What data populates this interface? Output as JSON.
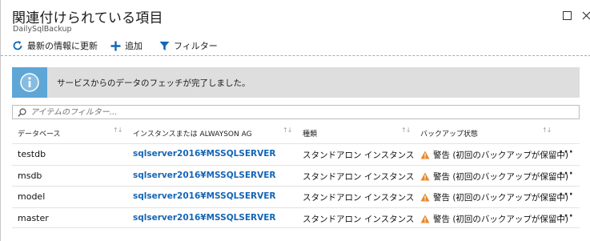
{
  "header": {
    "title": "関連付けられている項目",
    "subtitle": "DailySqlBackup"
  },
  "toolbar": {
    "refresh_label": "最新の情報に更新",
    "add_label": "追加",
    "filter_label": "フィルター"
  },
  "banner": {
    "message": "サービスからのデータのフェッチが完了しました。"
  },
  "filter": {
    "placeholder": "アイテムのフィルター..."
  },
  "grid": {
    "columns": [
      {
        "label": "データベース"
      },
      {
        "label": "インスタンスまたは ALWAYSON AG"
      },
      {
        "label": "種類"
      },
      {
        "label": "バックアップ状態"
      }
    ],
    "rows": [
      {
        "database": "testdb",
        "instance": "sqlserver2016¥MSSQLSERVER",
        "type": "スタンドアロン インスタンス",
        "status": "警告 (初回のバックアップが保留中)",
        "more": "···"
      },
      {
        "database": "msdb",
        "instance": "sqlserver2016¥MSSQLSERVER",
        "type": "スタンドアロン インスタンス",
        "status": "警告 (初回のバックアップが保留中)",
        "more": "···"
      },
      {
        "database": "model",
        "instance": "sqlserver2016¥MSSQLSERVER",
        "type": "スタンドアロン インスタンス",
        "status": "警告 (初回のバックアップが保留中)",
        "more": "···"
      },
      {
        "database": "master",
        "instance": "sqlserver2016¥MSSQLSERVER",
        "type": "スタンドアロン インスタンス",
        "status": "警告 (初回のバックアップが保留中)",
        "more": "···"
      }
    ]
  },
  "colors": {
    "accent": "#1565b7",
    "info_icon_bg": "#5ea6d6",
    "banner_bg": "#dedede",
    "warning": "#e8892b"
  },
  "icons": {
    "refresh": "refresh-icon",
    "add": "plus-icon",
    "filter": "funnel-icon",
    "info": "info-icon",
    "search": "search-icon",
    "warning": "warning-icon",
    "maximize": "maximize-icon",
    "close": "close-icon"
  }
}
